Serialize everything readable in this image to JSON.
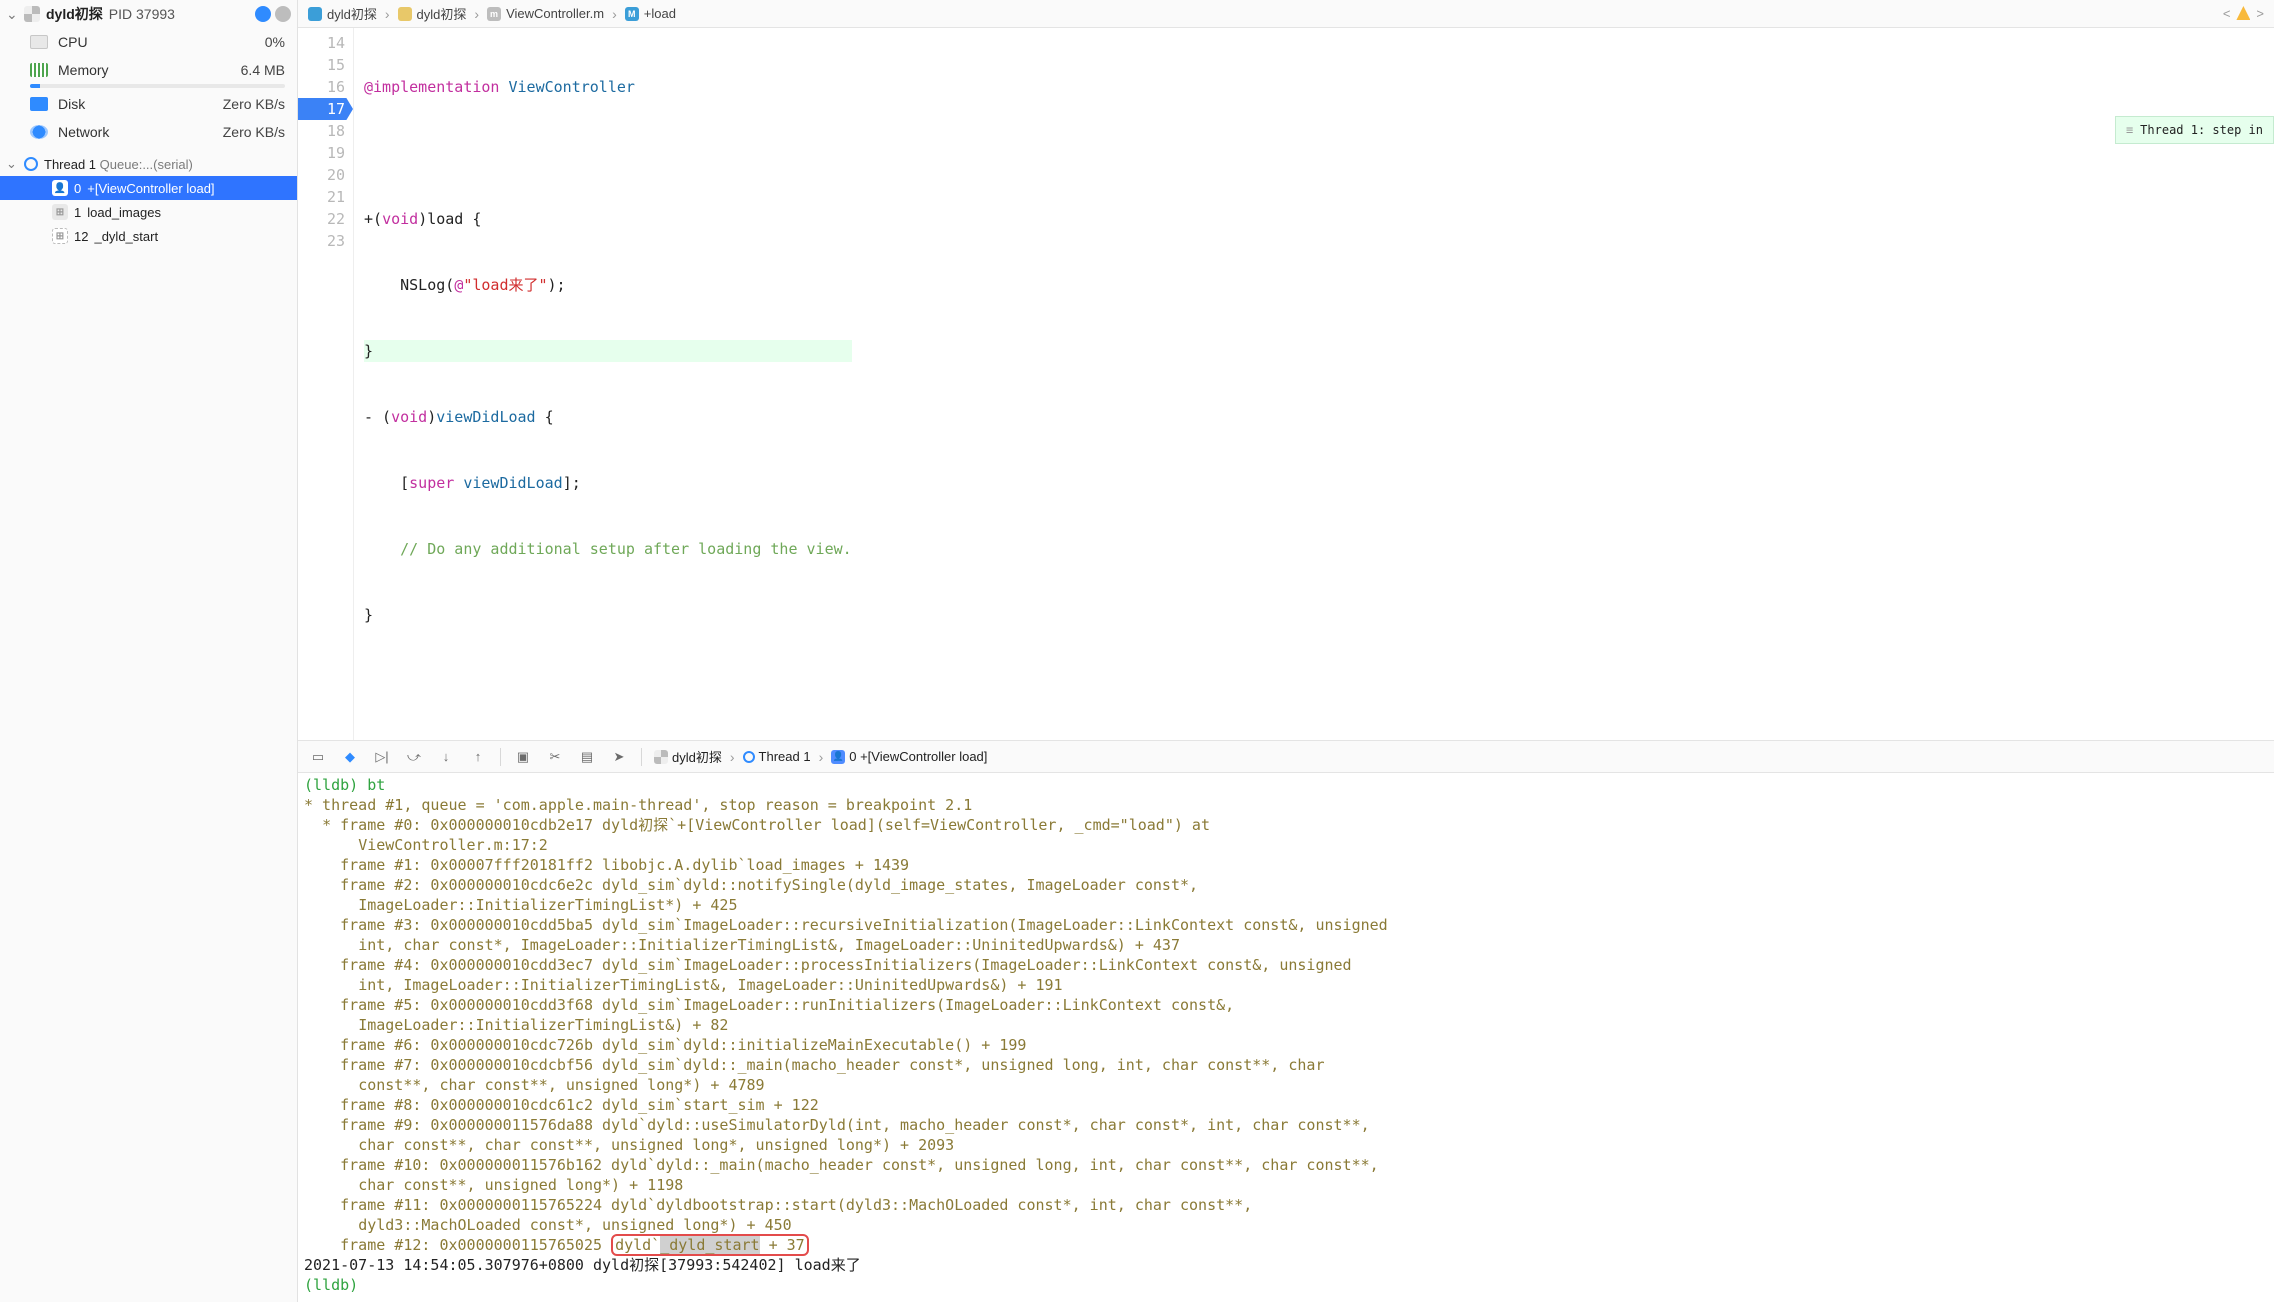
{
  "process": {
    "name": "dyld初探",
    "pid_label": "PID 37993"
  },
  "gauges": {
    "cpu": {
      "label": "CPU",
      "value": "0%"
    },
    "memory": {
      "label": "Memory",
      "value": "6.4 MB"
    },
    "disk": {
      "label": "Disk",
      "value": "Zero KB/s"
    },
    "network": {
      "label": "Network",
      "value": "Zero KB/s"
    }
  },
  "thread_header": {
    "name": "Thread 1",
    "queue": "Queue:...(serial)"
  },
  "frames": [
    {
      "idx": "0",
      "label": "+[ViewController load]",
      "kind": "user",
      "selected": true
    },
    {
      "idx": "1",
      "label": "load_images",
      "kind": "sys",
      "selected": false
    },
    {
      "idx": "12",
      "label": "_dyld_start",
      "kind": "dash",
      "selected": false
    }
  ],
  "jumpbar": {
    "project": "dyld初探",
    "folder": "dyld初探",
    "file": "ViewController.m",
    "symbol": "+load"
  },
  "code": {
    "lines": [
      "14",
      "15",
      "16",
      "17",
      "18",
      "19",
      "20",
      "21",
      "22",
      "23"
    ],
    "breakpoint_line": "17",
    "l14_kw": "@implementation",
    "l14_cls": "ViewController",
    "l16_a": "+(",
    "l16_void": "void",
    "l16_b": ")load {",
    "l17_a": "    NSLog(",
    "l17_at": "@",
    "l17_str": "\"load来了\"",
    "l17_b": ");",
    "l18": "}",
    "l19_a": "- (",
    "l19_void": "void",
    "l19_b": ")",
    "l19_m": "viewDidLoad",
    "l19_c": " {",
    "l20_a": "    [",
    "l20_super": "super",
    "l20_b": " ",
    "l20_m": "viewDidLoad",
    "l20_c": "];",
    "l21": "    // Do any additional setup after loading the view.",
    "l22": "}",
    "thread_badge": "Thread 1: step in"
  },
  "debugbar": {
    "crumb_target": "dyld初探",
    "crumb_thread": "Thread 1",
    "crumb_frame": "0 +[ViewController load]"
  },
  "console": {
    "prompt_bt": "(lldb) bt",
    "l1": "* thread #1, queue = 'com.apple.main-thread', stop reason = breakpoint 2.1",
    "l2": "  * frame #0: 0x000000010cdb2e17 dyld初探`+[ViewController load](self=ViewController, _cmd=\"load\") at",
    "l2b": "      ViewController.m:17:2",
    "l3": "    frame #1: 0x00007fff20181ff2 libobjc.A.dylib`load_images + 1439",
    "l4": "    frame #2: 0x000000010cdc6e2c dyld_sim`dyld::notifySingle(dyld_image_states, ImageLoader const*,",
    "l4b": "      ImageLoader::InitializerTimingList*) + 425",
    "l5": "    frame #3: 0x000000010cdd5ba5 dyld_sim`ImageLoader::recursiveInitialization(ImageLoader::LinkContext const&, unsigned",
    "l5b": "      int, char const*, ImageLoader::InitializerTimingList&, ImageLoader::UninitedUpwards&) + 437",
    "l6": "    frame #4: 0x000000010cdd3ec7 dyld_sim`ImageLoader::processInitializers(ImageLoader::LinkContext const&, unsigned",
    "l6b": "      int, ImageLoader::InitializerTimingList&, ImageLoader::UninitedUpwards&) + 191",
    "l7": "    frame #5: 0x000000010cdd3f68 dyld_sim`ImageLoader::runInitializers(ImageLoader::LinkContext const&,",
    "l7b": "      ImageLoader::InitializerTimingList&) + 82",
    "l8": "    frame #6: 0x000000010cdc726b dyld_sim`dyld::initializeMainExecutable() + 199",
    "l9": "    frame #7: 0x000000010cdcbf56 dyld_sim`dyld::_main(macho_header const*, unsigned long, int, char const**, char",
    "l9b": "      const**, char const**, unsigned long*) + 4789",
    "l10": "    frame #8: 0x000000010cdc61c2 dyld_sim`start_sim + 122",
    "l11": "    frame #9: 0x000000011576da88 dyld`dyld::useSimulatorDyld(int, macho_header const*, char const*, int, char const**,",
    "l11b": "      char const**, char const**, unsigned long*, unsigned long*) + 2093",
    "l12": "    frame #10: 0x000000011576b162 dyld`dyld::_main(macho_header const*, unsigned long, int, char const**, char const**,",
    "l12b": "      char const**, unsigned long*) + 1198",
    "l13": "    frame #11: 0x0000000115765224 dyld`dyldbootstrap::start(dyld3::MachOLoaded const*, int, char const**,",
    "l13b": "      dyld3::MachOLoaded const*, unsigned long*) + 450",
    "l14a": "    frame #12: 0x0000000115765025 ",
    "l14_box_a": "dyld`",
    "l14_box_sel": "_dyld_start",
    "l14_box_b": " + 37",
    "ts": "2021-07-13 14:54:05.307976+0800 dyld初探[37993:542402] load来了",
    "prompt": "(lldb) "
  }
}
